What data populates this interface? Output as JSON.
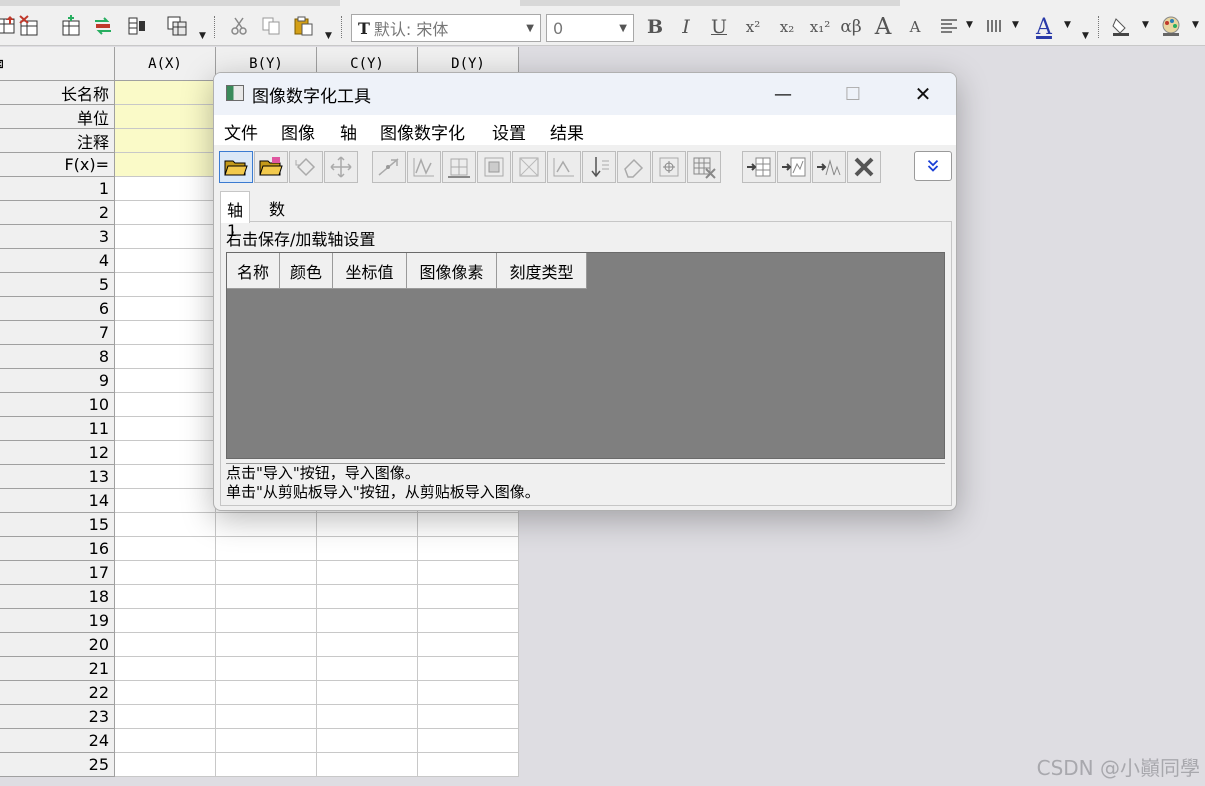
{
  "toolbar": {
    "font_name": "默认: 宋体",
    "font_size": "0",
    "bold_label": "B",
    "italic_label": "I",
    "underline_label": "U",
    "superscript_label": "x²",
    "subscript_label": "x₂",
    "supsub_label": "x₁²",
    "greek_label": "αβ",
    "grow_font_label": "A",
    "shrink_font_label": "A",
    "font_color_label": "A"
  },
  "sheet": {
    "columns": [
      "A(X)",
      "B(Y)",
      "C(Y)",
      "D(Y)"
    ],
    "meta_rows": [
      "长名称",
      "单位",
      "注释",
      "F(x)="
    ],
    "rows": [
      "1",
      "2",
      "3",
      "4",
      "5",
      "6",
      "7",
      "8",
      "9",
      "10",
      "11",
      "12",
      "13",
      "14",
      "15",
      "16",
      "17",
      "18",
      "19",
      "20",
      "21",
      "22",
      "23",
      "24",
      "25"
    ]
  },
  "dialog": {
    "title": "图像数字化工具",
    "minimize": "—",
    "maximize": "☐",
    "close": "✕",
    "menu": [
      "文件",
      "图像",
      "轴",
      "图像数字化",
      "设置",
      "结果"
    ],
    "tabs": [
      "轴 1",
      "数据"
    ],
    "panel_hint": "右击保存/加载轴设置",
    "table_headers": [
      "名称",
      "颜色",
      "坐标值",
      "图像像素",
      "刻度类型"
    ],
    "status_lines": [
      "点击\"导入\"按钮，导入图像。",
      "单击\"从剪贴板导入\"按钮，从剪贴板导入图像。"
    ]
  },
  "watermark": "CSDN @小巓同學",
  "colors": {
    "accent": "#3b7bd1",
    "meta_cell": "#fafac8",
    "table_bg": "#7f7f7f"
  }
}
